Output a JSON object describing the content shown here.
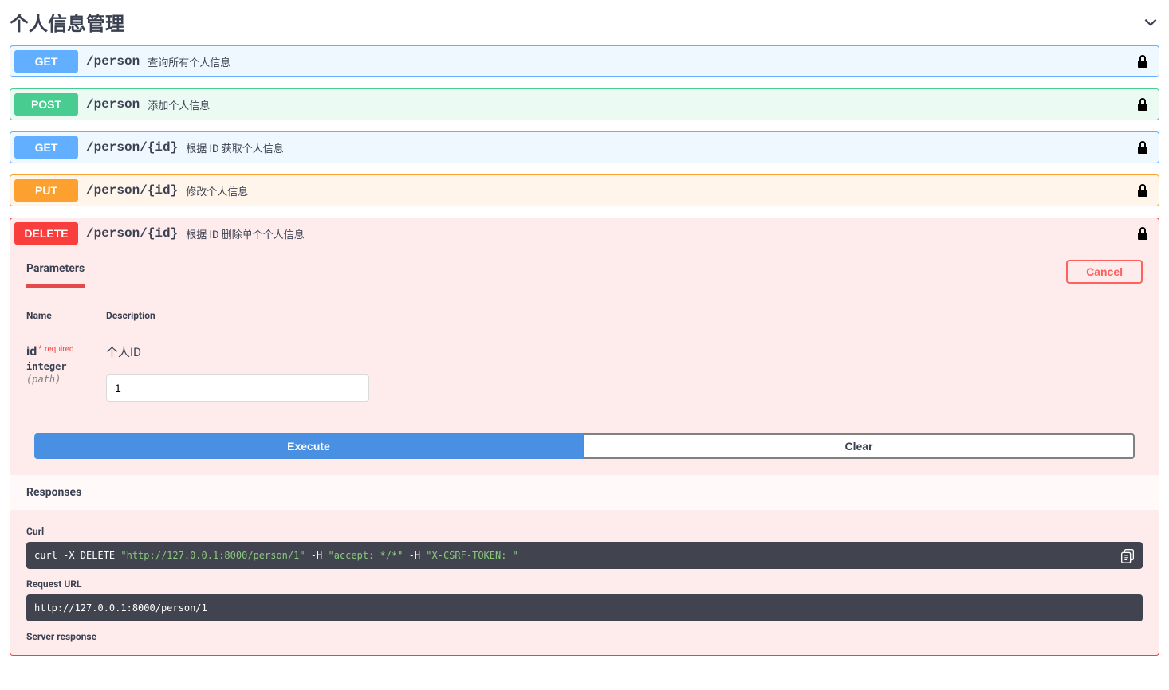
{
  "tag": {
    "name": "个人信息管理"
  },
  "ops": [
    {
      "method": "GET",
      "path": "/person",
      "desc": "查询所有个人信息",
      "cls": "get"
    },
    {
      "method": "POST",
      "path": "/person",
      "desc": "添加个人信息",
      "cls": "post"
    },
    {
      "method": "GET",
      "path": "/person/{id}",
      "desc": "根据 ID 获取个人信息",
      "cls": "get"
    },
    {
      "method": "PUT",
      "path": "/person/{id}",
      "desc": "修改个人信息",
      "cls": "put"
    }
  ],
  "open_op": {
    "method": "DELETE",
    "path": "/person/{id}",
    "desc": "根据 ID 删除单个个人信息",
    "cls": "delete"
  },
  "labels": {
    "parameters": "Parameters",
    "cancel": "Cancel",
    "name": "Name",
    "description": "Description",
    "required": "required",
    "execute": "Execute",
    "clear": "Clear",
    "responses": "Responses",
    "curl": "Curl",
    "request_url": "Request URL",
    "server_response": "Server response"
  },
  "params": [
    {
      "name": "id",
      "required": true,
      "type": "integer",
      "in": "(path)",
      "desc": "个人ID",
      "value": "1"
    }
  ],
  "curl": {
    "prefix": "curl -X DELETE ",
    "url": "\"http://127.0.0.1:8000/person/1\"",
    "mid1": " -H  ",
    "accept": "\"accept: */*\"",
    "mid2": " -H  ",
    "csrf": "\"X-CSRF-TOKEN: \""
  },
  "request_url": "http://127.0.0.1:8000/person/1"
}
